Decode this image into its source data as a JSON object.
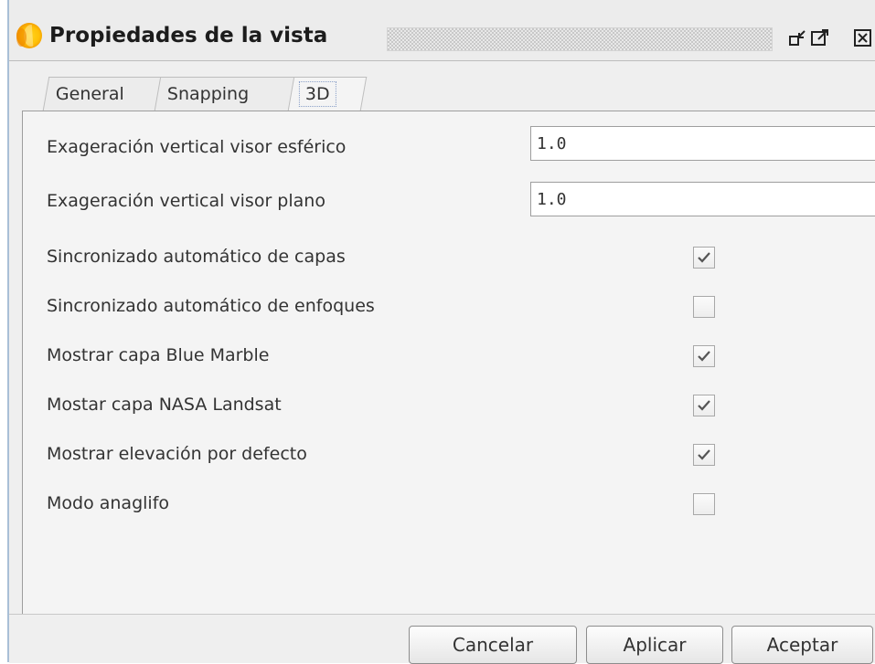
{
  "window": {
    "title": "Propiedades de la vista",
    "buttons": [
      "minimize-icon",
      "maximize-icon",
      "close-icon"
    ]
  },
  "tabs": [
    {
      "label": "General",
      "selected": false
    },
    {
      "label": "Snapping",
      "selected": false
    },
    {
      "label": "3D",
      "selected": true
    }
  ],
  "fields": [
    {
      "label": "Exageración vertical visor esférico",
      "value": "1.0"
    },
    {
      "label": "Exageración vertical visor plano",
      "value": "1.0"
    }
  ],
  "options": [
    {
      "label": "Sincronizado automático de capas",
      "checked": true
    },
    {
      "label": "Sincronizado automático de enfoques",
      "checked": false
    },
    {
      "label": "Mostrar capa Blue Marble",
      "checked": true
    },
    {
      "label": "Mostar capa NASA Landsat",
      "checked": true
    },
    {
      "label": "Mostrar elevación por defecto",
      "checked": true
    },
    {
      "label": "Modo anaglifo",
      "checked": false
    }
  ],
  "footer": {
    "cancel_label": "Cancelar",
    "apply_label": "Aplicar",
    "accept_label": "Aceptar"
  },
  "colors": {
    "background": "#efefef",
    "panel": "#f4f4f4",
    "border": "#9d9d9d",
    "text": "#333333",
    "check": "#555555"
  }
}
